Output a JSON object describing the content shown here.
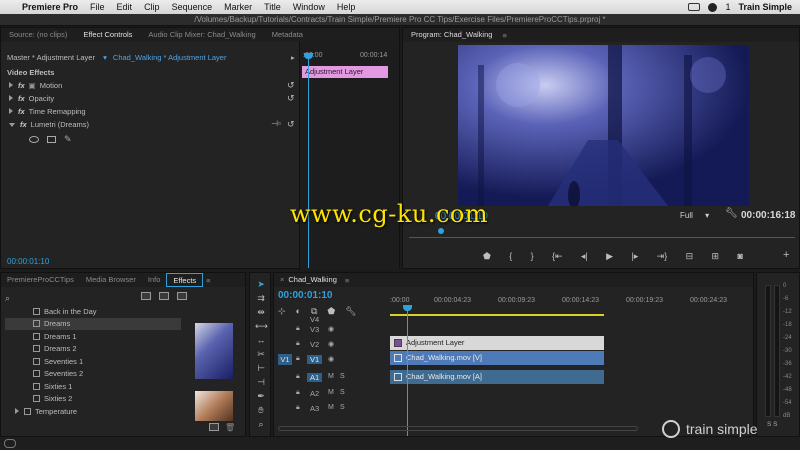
{
  "menubar": {
    "app": "Premiere Pro",
    "menus": [
      "File",
      "Edit",
      "Clip",
      "Sequence",
      "Marker",
      "Title",
      "Window",
      "Help"
    ],
    "badge": "1",
    "account": "Train Simple"
  },
  "window_title": "/Volumes/Backup/Tutorials/Contracts/Train Simple/Premiere Pro CC Tips/Exercise Files/PremiereProCCTips.prproj *",
  "effect_controls": {
    "tabs": [
      "Source: (no clips)",
      "Effect Controls",
      "Audio Clip Mixer: Chad_Walking",
      "Metadata"
    ],
    "breadcrumb_master": "Master * Adjustment Layer",
    "breadcrumb_sequence": "Chad_Walking * Adjustment Layer",
    "ruler_start": ":00:00",
    "ruler_end": "00:00:14",
    "clip_label": "Adjustment Layer",
    "section": "Video Effects",
    "fx_label": "fx",
    "effects": [
      "Motion",
      "Opacity",
      "Time Remapping",
      "Lumetri (Dreams)"
    ],
    "timecode": "00:00:01:10"
  },
  "program_monitor": {
    "tab": "Program: Chad_Walking",
    "timecode": "00:00:01:10",
    "zoom": "Full",
    "duration": "00:00:16:18"
  },
  "project_panel": {
    "tabs": [
      "PremiereProCCTips",
      "Media Browser",
      "Info",
      "Effects"
    ],
    "items": [
      "Back in the Day",
      "Dreams",
      "Dreams 1",
      "Dreams 2",
      "Seventies 1",
      "Seventies 2",
      "Sixties 1",
      "Sixties 2",
      "Temperature"
    ],
    "selected_index": 1
  },
  "timeline": {
    "tab": "Chad_Walking",
    "timecode": "00:00:01:10",
    "ruler": [
      ":00:00",
      "00:00:04:23",
      "00:00:09:23",
      "00:00:14:23",
      "00:00:19:23",
      "00:00:24:23"
    ],
    "tracks": [
      {
        "name": "V4",
        "kind": "video"
      },
      {
        "name": "V3",
        "kind": "video"
      },
      {
        "name": "V2",
        "kind": "video"
      },
      {
        "name": "V1",
        "kind": "video",
        "source": "V1"
      },
      {
        "name": "A1",
        "kind": "audio"
      },
      {
        "name": "A2",
        "kind": "audio"
      },
      {
        "name": "A3",
        "kind": "audio"
      }
    ],
    "mute_label": "M",
    "solo_label": "S",
    "clips": {
      "adjustment": "Adjustment Layer",
      "video": "Chad_Walking.mov [V]",
      "audio": "Chad_Walking.mov [A]"
    }
  },
  "audio_meter": {
    "scale": [
      "0",
      "-6",
      "-12",
      "-18",
      "-24",
      "-30",
      "-36",
      "-42",
      "-48",
      "-54",
      "dB"
    ],
    "footer": "S S"
  },
  "brand": "train simple",
  "watermark": "www.cg-ku.com",
  "colors": {
    "accent": "#2fa2dd",
    "adjustment_clip": "#e399e2",
    "video_clip": "#4f7ab8",
    "audio_clip": "#3e6b8f",
    "work_area": "#d8d12a",
    "watermark": "#ffe400"
  }
}
